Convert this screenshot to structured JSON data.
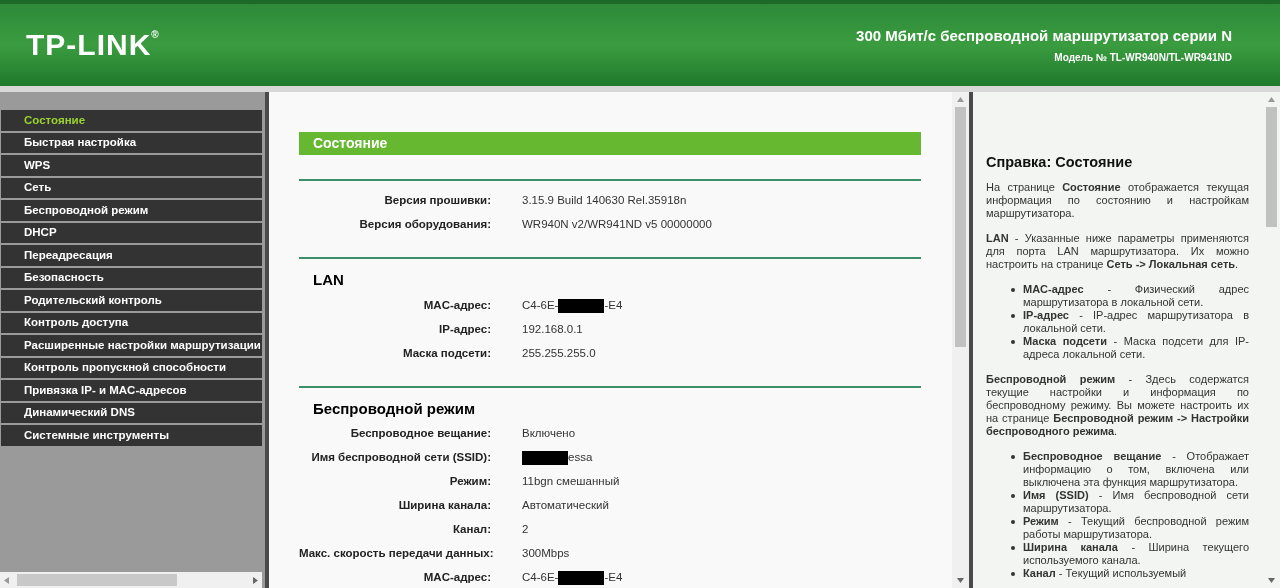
{
  "header": {
    "logo": "TP-LINK",
    "registered": "®",
    "title": "300 Мбит/с беспроводной маршрутизатор серии N",
    "model": "Модель № TL-WR940N/TL-WR941ND"
  },
  "sidebar": {
    "items": [
      {
        "label": "Состояние",
        "selected": true
      },
      {
        "label": "Быстрая настройка",
        "selected": false
      },
      {
        "label": "WPS",
        "selected": false
      },
      {
        "label": "Сеть",
        "selected": false
      },
      {
        "label": "Беспроводной режим",
        "selected": false
      },
      {
        "label": "DHCP",
        "selected": false
      },
      {
        "label": "Переадресация",
        "selected": false
      },
      {
        "label": "Безопасность",
        "selected": false
      },
      {
        "label": "Родительский контроль",
        "selected": false
      },
      {
        "label": "Контроль доступа",
        "selected": false
      },
      {
        "label": "Расширенные настройки маршрутизации",
        "selected": false
      },
      {
        "label": "Контроль пропускной способности",
        "selected": false
      },
      {
        "label": "Привязка IP- и MAC-адресов",
        "selected": false
      },
      {
        "label": "Динамический DNS",
        "selected": false
      },
      {
        "label": "Системные инструменты",
        "selected": false
      }
    ]
  },
  "main": {
    "title": "Состояние",
    "sections": [
      {
        "rows": [
          {
            "label": "Версия прошивки:",
            "value": "3.15.9 Build 140630 Rel.35918n"
          },
          {
            "label": "Версия оборудования:",
            "value": "WR940N v2/WR941ND v5 00000000"
          }
        ]
      },
      {
        "heading": "LAN",
        "rows": [
          {
            "label": "MAC-адрес:",
            "value": "C4-6E-",
            "redacted": true,
            "value_end": "-E4"
          },
          {
            "label": "IP-адрес:",
            "value": "192.168.0.1"
          },
          {
            "label": "Маска подсети:",
            "value": "255.255.255.0"
          }
        ]
      },
      {
        "heading": "Беспроводной режим",
        "rows": [
          {
            "label": "Беспроводное вещание:",
            "value": "Включено"
          },
          {
            "label": "Имя беспроводной сети (SSID):",
            "redacted": true,
            "value_end": "essa"
          },
          {
            "label": "Режим:",
            "value": "11bgn смешанный"
          },
          {
            "label": "Ширина канала:",
            "value": "Автоматический"
          },
          {
            "label": "Канал:",
            "value": "2"
          },
          {
            "label": "Макс. скорость передачи данных:",
            "value": "300Mbps"
          },
          {
            "label": "MAC-адрес:",
            "value": "C4-6E-",
            "redacted": true,
            "value_end": "-E4"
          }
        ]
      }
    ]
  },
  "help": {
    "title": "Справка: Состояние",
    "blocks": [
      {
        "kind": "paragraph",
        "text": "На странице **Состояние** отображается текущая информация по состоянию и настройкам маршрутизатора."
      },
      {
        "kind": "paragraph",
        "text": "**LAN** - Указанные ниже параметры применяются для порта LAN маршрутизатора. Их можно настроить на странице **Сеть -> Локальная сеть**."
      },
      {
        "kind": "list",
        "items": [
          "**MAC-адрес** - Физический адрес маршрутизатора в локальной сети.",
          "**IP-адрес** - IP-адрес маршрутизатора в локальной сети.",
          "**Маска подсети** - Маска подсети для IP-адреса локальной сети."
        ]
      },
      {
        "kind": "paragraph",
        "text": "**Беспроводной режим** - Здесь содержатся текущие настройки и информация по беспроводному режиму. Вы можете настроить их на странице **Беспроводной режим -> Настройки беспроводного режима**."
      },
      {
        "kind": "list",
        "items": [
          "**Беспроводное вещание** - Отображает информацию о том, включена или выключена эта функция маршрутизатора.",
          "**Имя (SSID)** - Имя беспроводной сети маршрутизатора.",
          "**Режим** - Текущий беспроводной режим работы маршрутизатора.",
          "**Ширина канала** - Ширина текущего используемого канала.",
          "**Канал** - Текущий используемый"
        ]
      }
    ]
  }
}
